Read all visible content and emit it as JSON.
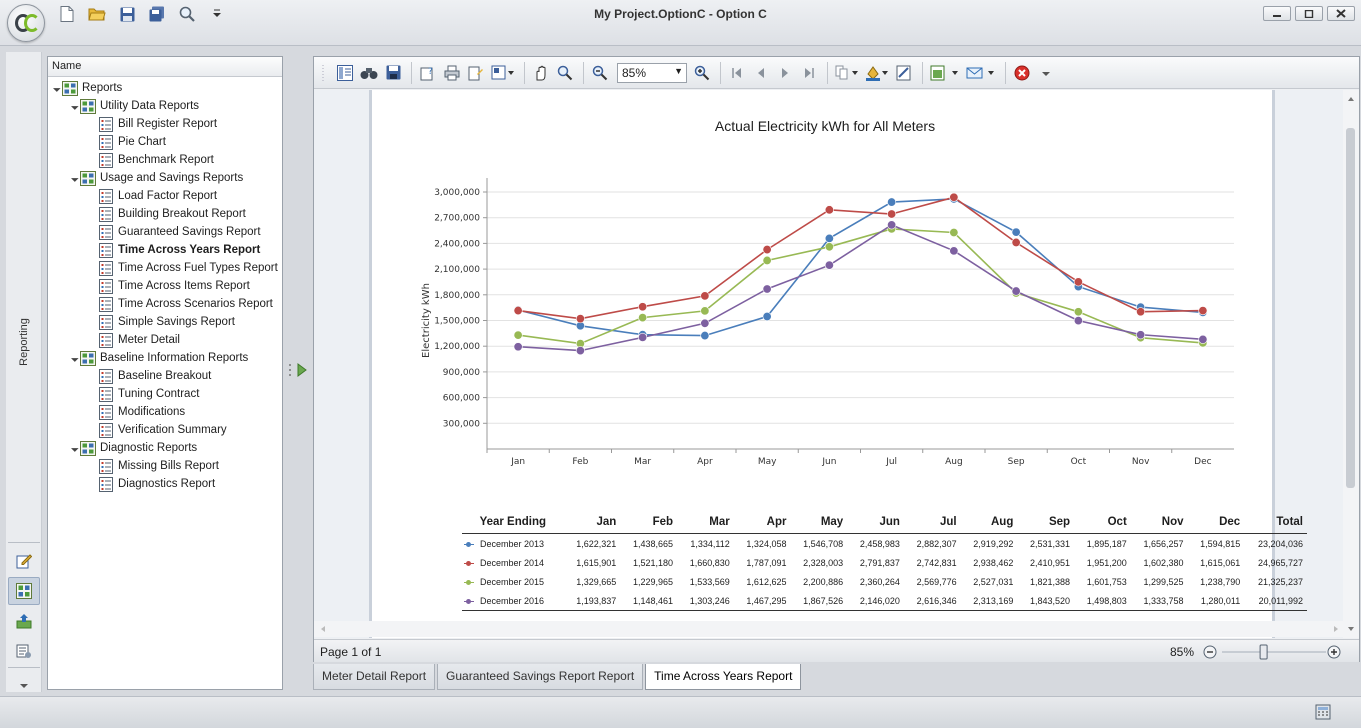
{
  "window": {
    "title": "My Project.OptionC - Option C"
  },
  "sidebar": {
    "label": "Reporting"
  },
  "tree": {
    "header": "Name",
    "nodes": [
      {
        "label": "Reports",
        "level": 0,
        "kind": "group",
        "expanded": true
      },
      {
        "label": "Utility Data Reports",
        "level": 1,
        "kind": "group",
        "expanded": true
      },
      {
        "label": "Bill Register Report",
        "level": 2,
        "kind": "report"
      },
      {
        "label": "Pie Chart",
        "level": 2,
        "kind": "report"
      },
      {
        "label": "Benchmark Report",
        "level": 2,
        "kind": "report"
      },
      {
        "label": "Usage and Savings Reports",
        "level": 1,
        "kind": "group",
        "expanded": true
      },
      {
        "label": "Load Factor Report",
        "level": 2,
        "kind": "report"
      },
      {
        "label": "Building Breakout Report",
        "level": 2,
        "kind": "report"
      },
      {
        "label": "Guaranteed Savings Report",
        "level": 2,
        "kind": "report"
      },
      {
        "label": "Time Across Years Report",
        "level": 2,
        "kind": "report",
        "selected": true
      },
      {
        "label": "Time Across Fuel Types Report",
        "level": 2,
        "kind": "report"
      },
      {
        "label": "Time Across Items Report",
        "level": 2,
        "kind": "report"
      },
      {
        "label": "Time Across Scenarios Report",
        "level": 2,
        "kind": "report"
      },
      {
        "label": "Simple Savings Report",
        "level": 2,
        "kind": "report"
      },
      {
        "label": "Meter Detail",
        "level": 2,
        "kind": "report"
      },
      {
        "label": "Baseline Information Reports",
        "level": 1,
        "kind": "group",
        "expanded": true
      },
      {
        "label": "Baseline Breakout",
        "level": 2,
        "kind": "report"
      },
      {
        "label": "Tuning Contract",
        "level": 2,
        "kind": "report"
      },
      {
        "label": "Modifications",
        "level": 2,
        "kind": "report"
      },
      {
        "label": "Verification Summary",
        "level": 2,
        "kind": "report"
      },
      {
        "label": "Diagnostic Reports",
        "level": 1,
        "kind": "group",
        "expanded": true
      },
      {
        "label": "Missing Bills Report",
        "level": 2,
        "kind": "report"
      },
      {
        "label": "Diagnostics Report",
        "level": 2,
        "kind": "report"
      }
    ]
  },
  "viewer": {
    "zoom": "85%",
    "page_status": "Page 1 of 1",
    "zoom_status": "85%",
    "zoom_slider_level": 0.4
  },
  "chart_data": {
    "type": "line",
    "title": "Actual Electricity kWh for All Meters",
    "xlabel": "",
    "ylabel": "Electricity kWh",
    "ylim": [
      0,
      3000000
    ],
    "yticks": [
      "300,000",
      "600,000",
      "900,000",
      "1,200,000",
      "1,500,000",
      "1,800,000",
      "2,100,000",
      "2,400,000",
      "2,700,000",
      "3,000,000"
    ],
    "categories": [
      "Jan",
      "Feb",
      "Mar",
      "Apr",
      "May",
      "Jun",
      "Jul",
      "Aug",
      "Sep",
      "Oct",
      "Nov",
      "Dec"
    ],
    "grid": true,
    "series": [
      {
        "name": "December 2013",
        "color": "#4a7ebb",
        "values": [
          1622321,
          1438665,
          1334112,
          1324058,
          1546708,
          2458983,
          2882307,
          2919292,
          2531331,
          1895187,
          1656257,
          1594815
        ],
        "total": "23,204,036"
      },
      {
        "name": "December 2014",
        "color": "#be4b48",
        "values": [
          1615901,
          1521180,
          1660830,
          1787091,
          2328003,
          2791837,
          2742831,
          2938462,
          2410951,
          1951200,
          1602380,
          1615061
        ],
        "total": "24,965,727"
      },
      {
        "name": "December 2015",
        "color": "#98b954",
        "values": [
          1329665,
          1229965,
          1533569,
          1612625,
          2200886,
          2360264,
          2569776,
          2527031,
          1821388,
          1601753,
          1299525,
          1238790
        ],
        "total": "21,325,237"
      },
      {
        "name": "December 2016",
        "color": "#7d60a0",
        "values": [
          1193837,
          1148461,
          1303246,
          1467295,
          1867526,
          2146020,
          2616346,
          2313169,
          1843520,
          1498803,
          1333758,
          1280011
        ],
        "total": "20,011,992"
      }
    ]
  },
  "table": {
    "headers": [
      "Year Ending",
      "Jan",
      "Feb",
      "Mar",
      "Apr",
      "May",
      "Jun",
      "Jul",
      "Aug",
      "Sep",
      "Oct",
      "Nov",
      "Dec",
      "Total"
    ]
  },
  "doc_tabs": [
    {
      "label": "Meter Detail Report",
      "active": false
    },
    {
      "label": "Guaranteed Savings Report Report",
      "active": false
    },
    {
      "label": "Time Across Years Report",
      "active": true
    }
  ]
}
